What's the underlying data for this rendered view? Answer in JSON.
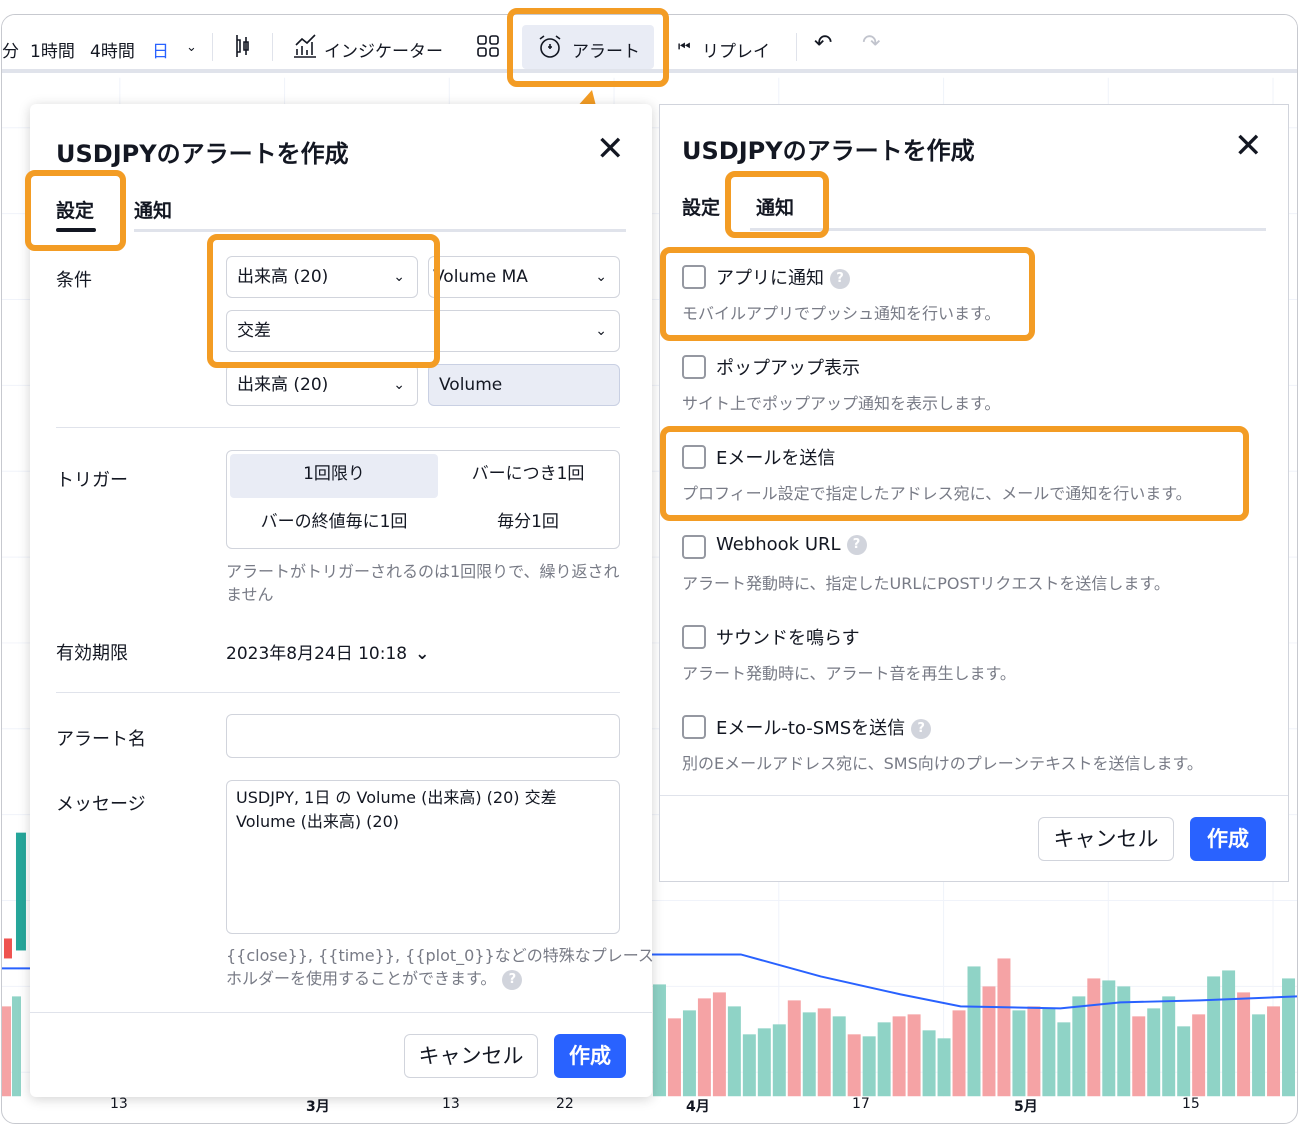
{
  "toolbar": {
    "partial": "分",
    "interval_1h": "1時間",
    "interval_4h": "4時間",
    "interval_day": "日",
    "indicators": "インジケーター",
    "alert": "アラート",
    "replay": "リプレイ"
  },
  "chart": {
    "x_ticks": [
      "13",
      "3月",
      "13",
      "22",
      "4月",
      "17",
      "5月",
      "15"
    ],
    "volume_colors": {
      "up": "#8fd3c6",
      "down": "#f5a3a5"
    },
    "ma_color": "#2962ff"
  },
  "left_dialog": {
    "title": "USDJPYのアラートを作成",
    "tabs": {
      "settings": "設定",
      "notify": "通知"
    },
    "condition_label": "条件",
    "condition_source": "出来高 (20)",
    "condition_plot": "Volume MA",
    "condition_operator": "交差",
    "condition_target_source": "出来高 (20)",
    "condition_target_plot": "Volume",
    "trigger_label": "トリガー",
    "trigger_options": [
      "1回限り",
      "バーにつき1回",
      "バーの終値毎に1回",
      "毎分1回"
    ],
    "trigger_hint": "アラートがトリガーされるのは1回限りで、繰り返されません",
    "expiry_label": "有効期限",
    "expiry_value": "2023年8月24日 10:18",
    "name_label": "アラート名",
    "name_value": "",
    "message_label": "メッセージ",
    "message_line1": "USDJPY, 1日 の Volume (出来高) (20) 交差",
    "message_line2": "Volume (出来高) (20)",
    "placeholder_hint_line1": "{{close}}, {{time}}, {{plot_0}}などの特殊なプレース",
    "placeholder_hint_line2": "ホルダーを使用することができます。",
    "cancel": "キャンセル",
    "create": "作成"
  },
  "right_dialog": {
    "title": "USDJPYのアラートを作成",
    "tabs": {
      "settings": "設定",
      "notify": "通知"
    },
    "options": [
      {
        "label": "アプリに通知",
        "desc": "モバイルアプリでプッシュ通知を行います。",
        "checked": false
      },
      {
        "label": "ポップアップ表示",
        "desc": "サイト上でポップアップ通知を表示します。",
        "checked": false
      },
      {
        "label": "Eメールを送信",
        "desc": "プロフィール設定で指定したアドレス宛に、メールで通知を行います。",
        "checked": false
      },
      {
        "label": "Webhook URL",
        "desc": "アラート発動時に、指定したURLにPOSTリクエストを送信します。",
        "checked": false
      },
      {
        "label": "サウンドを鳴らす",
        "desc": "アラート発動時に、アラート音を再生します。",
        "checked": false
      },
      {
        "label": "Eメール-to-SMSを送信",
        "desc": "別のEメールアドレス宛に、SMS向けのプレーンテキストを送信します。",
        "checked": false
      }
    ],
    "cancel": "キャンセル",
    "create": "作成"
  },
  "accent_color": "#f39c24"
}
